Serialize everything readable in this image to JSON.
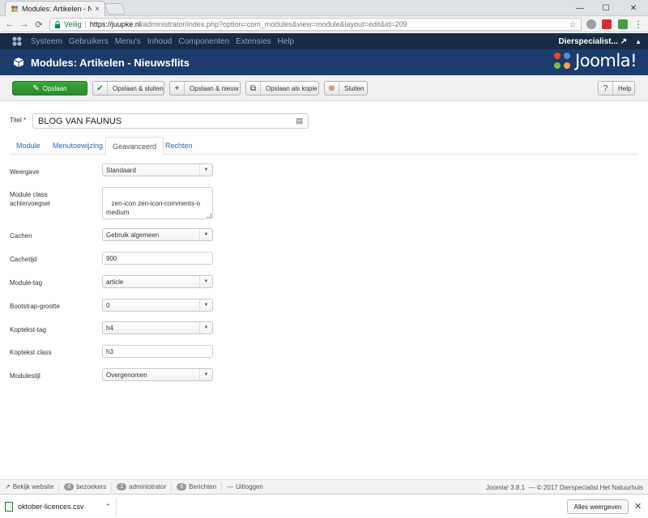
{
  "browser": {
    "tab_title": "Modules: Artikelen - Nie",
    "tab_close": "×",
    "security_label": "Veilig",
    "url_host": "https://juupke.nl",
    "url_rest": "/administrator/index.php?option=com_modules&view=module&layout=edit&id=209",
    "back": "←",
    "forward": "→",
    "reload": "⟳",
    "star": "☆",
    "minimize": "—",
    "maximize": "☐",
    "close": "✕"
  },
  "joomla_nav": {
    "items": [
      "Systeem",
      "Gebruikers",
      "Menu's",
      "Inhoud",
      "Componenten",
      "Extensies",
      "Help"
    ],
    "site_name": "Dierspecialist...",
    "external_icon": "↗",
    "user_icon": "▲"
  },
  "header": {
    "title": "Modules: Artikelen - Nieuwsflits",
    "brand": "Joomla!"
  },
  "toolbar": {
    "save": "Opslaan",
    "save_close": "Opslaan & sluiten",
    "save_new": "Opslaan & nieuw",
    "save_copy": "Opslaan als kopie",
    "close": "Sluiten",
    "help": "Help"
  },
  "form": {
    "title_label": "Titel *",
    "title_value": "BLOG VAN FAUNUS"
  },
  "tabs": [
    "Module",
    "Menutoewijzing",
    "Geavanceerd",
    "Rechten"
  ],
  "active_tab": "Geavanceerd",
  "fields": {
    "weergave": {
      "label": "Weergave",
      "value": "Standaard"
    },
    "module_class": {
      "label": "Module class achtervoegsel",
      "value": " zen-icon zen-icon-comments-o medium"
    },
    "cachen": {
      "label": "Cachen",
      "value": "Gebruik algemeen"
    },
    "cachetijd": {
      "label": "Cachetijd",
      "value": "900"
    },
    "module_tag": {
      "label": "Module-tag",
      "value": "article"
    },
    "bootstrap": {
      "label": "Bootstrap-grootte",
      "value": "0"
    },
    "koptekst_tag": {
      "label": "Koptekst-tag",
      "value": "h4"
    },
    "koptekst_class": {
      "label": "Koptekst class",
      "value": "h3"
    },
    "modulestijl": {
      "label": "Modulestijl",
      "value": "Overgenomen"
    }
  },
  "statusbar": {
    "view_site": "Bekijk website",
    "visitors_count": "0",
    "visitors_label": "bezoekers",
    "admin_count": "1",
    "admin_label": "administrator",
    "messages_count": "0",
    "messages_label": "Berichten",
    "logout": "Uitloggen",
    "version": "Joomla! 3.8.1",
    "copyright": "— © 2017 Dierspecialist Het Natuurhuis"
  },
  "downloads": {
    "file": "oktober-licences.csv",
    "show_all": "Alles weergeven",
    "close": "✕"
  },
  "colors": {
    "nav_bg": "#1a2a42",
    "header_bg": "#1c3d6c",
    "primary_green": "#2d8a2d",
    "link_blue": "#2a69b8"
  }
}
